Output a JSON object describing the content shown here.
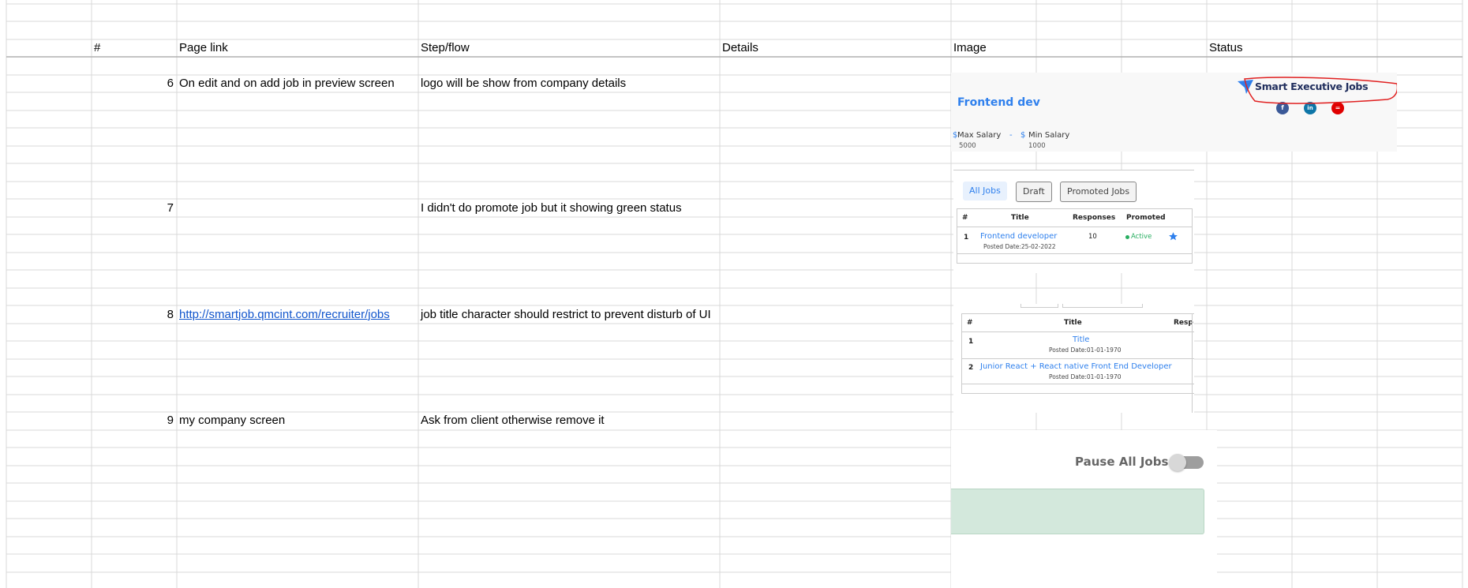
{
  "header": {
    "num": "#",
    "page_link": "Page link",
    "step_flow": "Step/flow",
    "details": "Details",
    "image": "Image",
    "status": "Status"
  },
  "rows": [
    {
      "num": "6",
      "page_link": "On edit and on add job in preview screen",
      "step_flow": "logo will be show from company details"
    },
    {
      "num": "7",
      "page_link": "",
      "step_flow": "I didn't do promote job but it showing green status"
    },
    {
      "num": "8",
      "page_link": "http://smartjob.qmcint.com/recruiter/jobs",
      "step_flow": "job title character should restrict to prevent disturb of UI"
    },
    {
      "num": "9",
      "page_link": "my company screen",
      "step_flow": "Ask from client otherwise remove it"
    }
  ],
  "shot1": {
    "job_title": "Frontend dev",
    "brand": "Smart Executive Jobs",
    "max_label": "Max Salary",
    "max_value": "5000",
    "dash": "-",
    "currency": "$",
    "min_label": "Min Salary",
    "min_value": "1000",
    "social": [
      "f",
      "in",
      "="
    ],
    "colors": {
      "accent": "#2f80ed",
      "annotation": "#e02020"
    }
  },
  "shot2": {
    "tabs": [
      "All Jobs",
      "Draft",
      "Promoted Jobs"
    ],
    "columns": [
      "#",
      "Title",
      "Responses",
      "Promoted"
    ],
    "row": {
      "num": "1",
      "title": "Frontend developer",
      "posted": "Posted Date:25-02-2022",
      "responses": "10",
      "status": "Active"
    }
  },
  "shot3": {
    "columns": [
      "#",
      "Title",
      "Resp"
    ],
    "rows": [
      {
        "num": "1",
        "title": "Title",
        "posted": "Posted Date:01-01-1970"
      },
      {
        "num": "2",
        "title": "Junior React + React native Front End Developer",
        "posted": "Posted Date:01-01-1970"
      }
    ]
  },
  "shot4": {
    "toggle_label": "Pause All Jobs",
    "toggle_on": false
  }
}
